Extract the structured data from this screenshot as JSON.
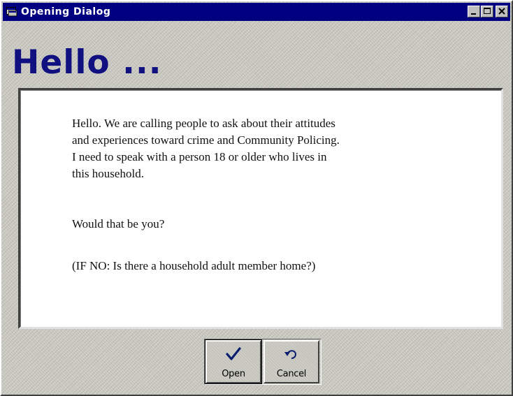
{
  "window": {
    "title": "Opening Dialog",
    "minimize_label": "_",
    "maximize_label": "□",
    "close_label": "×"
  },
  "heading": "Hello ...",
  "body": {
    "intro_lines": [
      "Hello. We are calling people to ask about their attitudes",
      "and experiences toward crime and Community Policing.",
      "I need to speak with a person 18 or older who lives in",
      "this household."
    ],
    "question": "Would that be you?",
    "instruction": "(IF NO: Is there a household adult member home?)"
  },
  "buttons": {
    "open": {
      "label": "Open",
      "icon": "checkmark-icon"
    },
    "cancel": {
      "label": "Cancel",
      "icon": "undo-arrow-icon"
    }
  },
  "colors": {
    "titlebar": "#000080",
    "heading": "#101080",
    "background": "#c8c8c0",
    "content": "#ffffff"
  }
}
